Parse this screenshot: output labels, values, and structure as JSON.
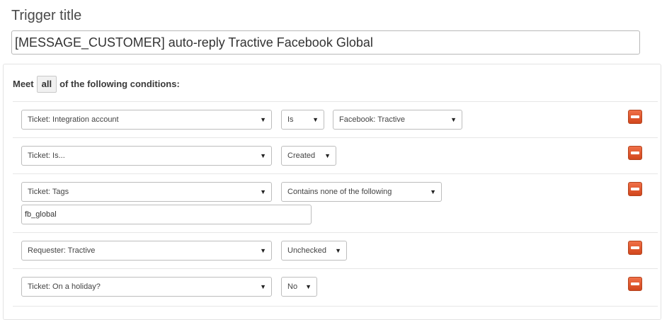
{
  "trigger": {
    "title_label": "Trigger title",
    "title_value": "[MESSAGE_CUSTOMER] auto-reply Tractive Facebook Global"
  },
  "meet": {
    "prefix": "Meet",
    "selected": "all",
    "suffix": "of the following conditions:"
  },
  "conditions": [
    {
      "field": "Ticket: Integration account",
      "operator": "Is",
      "value": "Facebook: Tractive"
    },
    {
      "field": "Ticket: Is...",
      "operator": "Created"
    },
    {
      "field": "Ticket: Tags",
      "operator": "Contains none of the following",
      "input_value": "fb_global"
    },
    {
      "field": "Requester: Tractive",
      "operator": "Unchecked"
    },
    {
      "field": "Ticket: On a holiday?",
      "operator": "No"
    }
  ],
  "icons": {
    "dropdown": "chevron-down-icon",
    "remove": "minus-icon"
  },
  "colors": {
    "remove_button": "#e05a30"
  }
}
